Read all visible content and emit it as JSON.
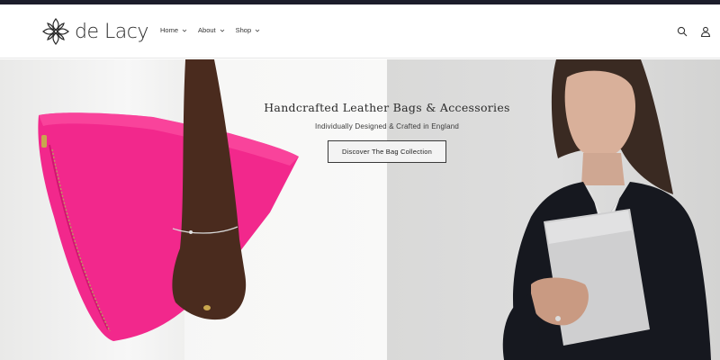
{
  "brand": {
    "name": "de Lacy",
    "logo_icon": "quatrefoil-ornament-icon"
  },
  "nav": {
    "items": [
      {
        "label": "Home",
        "icon": "chevron-down-icon"
      },
      {
        "label": "About",
        "icon": "chevron-down-icon"
      },
      {
        "label": "Shop",
        "icon": "chevron-down-icon"
      }
    ]
  },
  "header_icons": [
    "search-icon",
    "user-icon"
  ],
  "hero": {
    "title": "Handcrafted Leather Bags & Accessories",
    "subtitle": "Individually Designed & Crafted in England",
    "cta_label": "Discover The Bag Collection"
  },
  "colors": {
    "top_strip": "#1c1d2b",
    "clutch_pink": "#f2288c",
    "jacket": "#16181f",
    "silver_bag": "#cfcfd0"
  }
}
